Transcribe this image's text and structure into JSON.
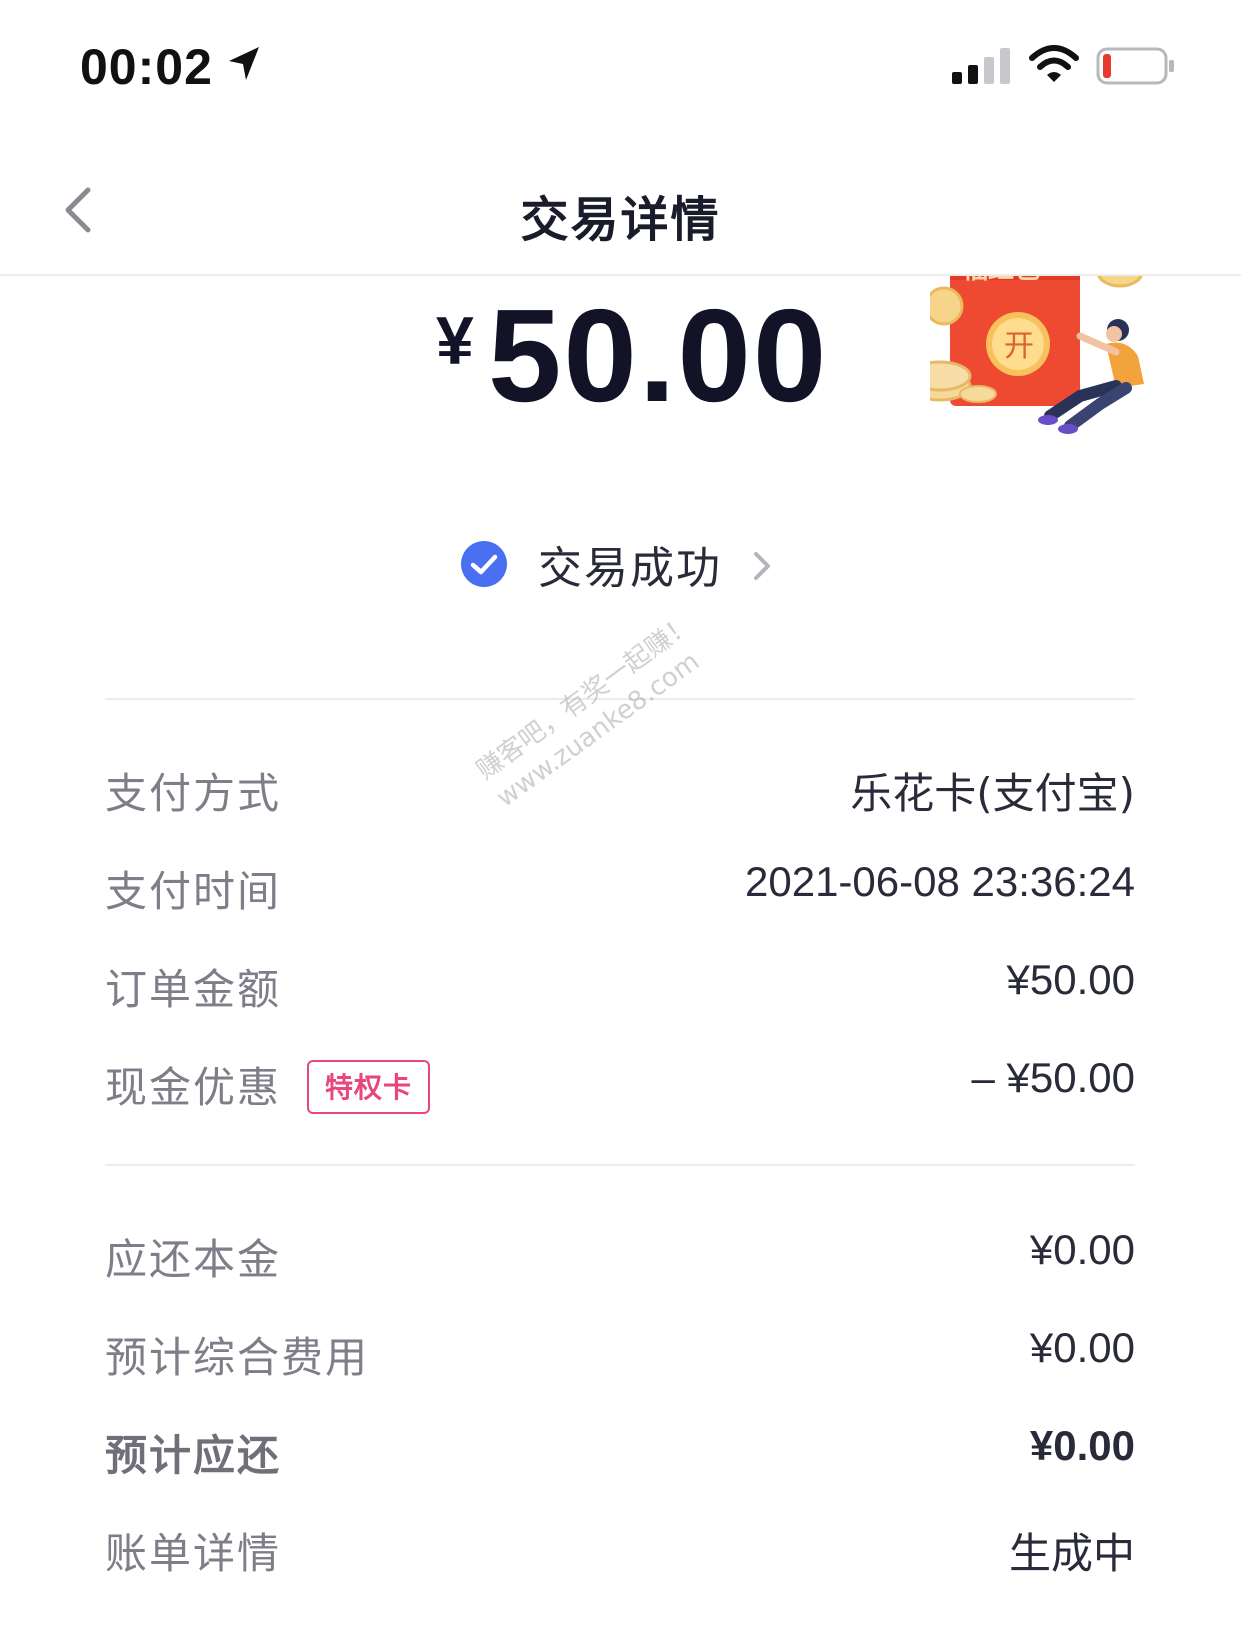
{
  "status_bar": {
    "time": "00:02",
    "icons": [
      "location-arrow-icon",
      "signal-icon",
      "wifi-icon",
      "battery-icon"
    ],
    "battery_level_percent": 10,
    "battery_color": "#e8392f"
  },
  "nav": {
    "back_icon": "chevron-left-icon",
    "title": "交易详情"
  },
  "amount": {
    "currency": "¥",
    "value": "50.00"
  },
  "promo": {
    "button_text": "开",
    "banner_text": "福红包"
  },
  "status": {
    "icon": "check-circle-icon",
    "text": "交易成功",
    "accent": "#4a6ff0"
  },
  "payment": {
    "method_label": "支付方式",
    "method_value": "乐花卡(支付宝)",
    "time_label": "支付时间",
    "time_value": "2021-06-08 23:36:24",
    "order_label": "订单金额",
    "order_value": "¥50.00",
    "discount_label": "现金优惠",
    "discount_badge": "特权卡",
    "discount_value": "– ¥50.00"
  },
  "repay": {
    "principal_label": "应还本金",
    "principal_value": "¥0.00",
    "fee_label": "预计综合费用",
    "fee_value": "¥0.00",
    "total_label": "预计应还",
    "total_value": "¥0.00",
    "bill_label": "账单详情",
    "bill_value": "生成中"
  },
  "watermark": {
    "line1": "赚客吧，有奖一起赚！",
    "line2": "www.zuanke8.com"
  },
  "colors": {
    "badge": "#e8477d",
    "label": "#7d7e88",
    "value": "#2a2b3a"
  }
}
